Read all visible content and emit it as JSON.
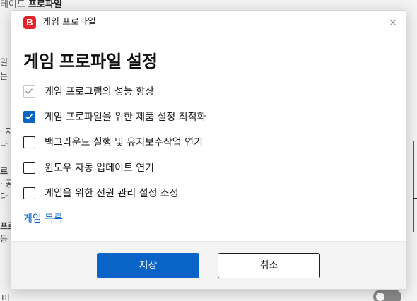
{
  "background": {
    "top_fragment_a": "테이드",
    "top_fragment_b": "프로파일",
    "left_fragments": [
      "일",
      "는",
      "· 자",
      "다",
      "르",
      "· 공",
      "다",
      "프로",
      "동"
    ],
    "bottom_fragment": "미"
  },
  "dialog": {
    "title": "게임 프로파일",
    "app_logo_letter": "B",
    "heading": "게임 프로파일 설정",
    "options": [
      {
        "label": "게임 프로그램의 성능 향상",
        "checked": true,
        "disabled": true
      },
      {
        "label": "게임 프로파일을 위한 제품 설정 최적화",
        "checked": true,
        "disabled": false
      },
      {
        "label": "백그라운드 실행 및 유지보수작업 연기",
        "checked": false,
        "disabled": false
      },
      {
        "label": "윈도우 자동 업데이트 연기",
        "checked": false,
        "disabled": false
      },
      {
        "label": "게임을 위한 전원 관리 설정 조정",
        "checked": false,
        "disabled": false
      }
    ],
    "link_label": "게임 목록",
    "save_label": "저장",
    "cancel_label": "취소",
    "close_icon": "close-icon"
  },
  "colors": {
    "accent": "#0a64c8",
    "logo": "#e3242b",
    "disabled_check": "#9a9a9a"
  }
}
